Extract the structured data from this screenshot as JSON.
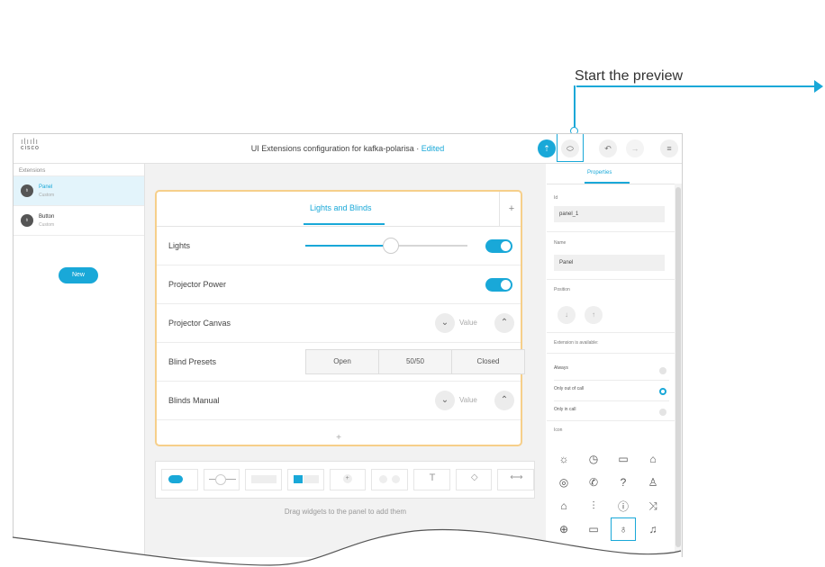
{
  "callout": {
    "text": "Start the preview",
    "color": "#19a8d8"
  },
  "header": {
    "logo_text": "cisco",
    "title": "UI Extensions configuration for kafka-polarisa",
    "separator": " · ",
    "edited": "Edited"
  },
  "sidebar": {
    "heading": "Extensions",
    "items": [
      {
        "name": "Panel",
        "type": "Custom"
      },
      {
        "name": "Button",
        "type": "Custom"
      }
    ],
    "new_label": "New"
  },
  "panel": {
    "tab_label": "Lights and Blinds",
    "add_tab": "+",
    "rows": {
      "lights": "Lights",
      "projector_power": "Projector Power",
      "projector_canvas": "Projector Canvas",
      "blind_presets": "Blind Presets",
      "blinds_manual": "Blinds Manual"
    },
    "slider_level": 0.52,
    "spinner_value": "Value",
    "presets": [
      "Open",
      "50/50",
      "Closed"
    ],
    "add_row": "+"
  },
  "palette": {
    "drag_hint": "Drag widgets to the panel to add them"
  },
  "properties": {
    "tab_label": "Properties",
    "id_label": "Id",
    "id_value": "panel_1",
    "name_label": "Name",
    "name_value": "Panel",
    "position_label": "Position",
    "availability_label": "Extension is available:",
    "options": [
      "Always",
      "Only out of call",
      "Only in call"
    ],
    "selected_option": 1,
    "icon_label": "Icon"
  }
}
